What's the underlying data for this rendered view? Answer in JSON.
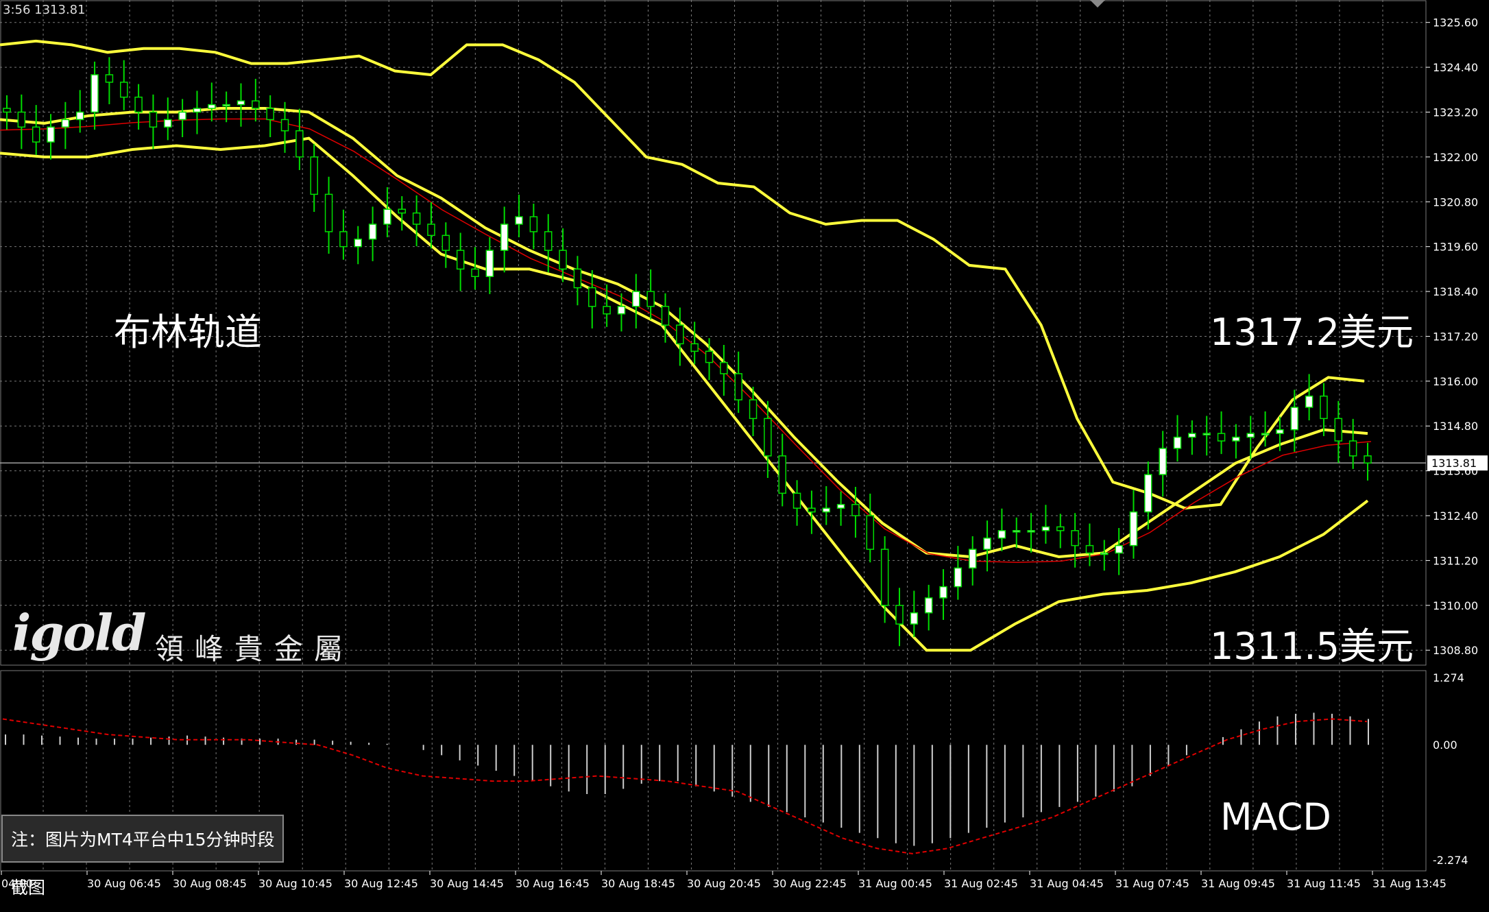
{
  "header": {
    "readout": "3:56 1313.81"
  },
  "annotations": {
    "bollinger_label": "布林轨道",
    "upper_price": "1317.2美元",
    "lower_price": "1311.5美元",
    "macd_label": "MACD",
    "note": "注：图片为MT4平台中15分钟时段截图"
  },
  "logo": {
    "main": "igold",
    "sub": "領峰貴金屬"
  },
  "colors": {
    "background": "#000000",
    "grid": "#7a7a7a",
    "bollinger": "#ffff3c",
    "moving_average": "#e00000",
    "signal": "#e00000",
    "bull_candle": "#ffffff",
    "wick": "#00dd00",
    "histogram": "#cfcfcf",
    "price_line": "#a0a0a0",
    "current_price_box": "#ffffff"
  },
  "chart_data": [
    {
      "type": "candlestick",
      "title": "",
      "current_price": 1313.81,
      "ylim": [
        1308.4,
        1326.2
      ],
      "y_ticks": [
        1325.6,
        1324.4,
        1323.2,
        1322.0,
        1320.8,
        1319.6,
        1318.4,
        1317.2,
        1316.0,
        1314.8,
        1313.6,
        1312.4,
        1311.2,
        1310.0,
        1308.8
      ],
      "y_tick_labels": [
        "1325.60",
        "1324.40",
        "1323.20",
        "1322.00",
        "1320.80",
        "1319.60",
        "1318.40",
        "1317.20",
        "1316.00",
        "1314.80",
        "1313.60",
        "1312.40",
        "1311.20",
        "1310.00",
        "1308.80"
      ],
      "current_price_label": "1313.81",
      "x_ticks": [
        "04:00",
        "30 Aug 06:45",
        "30 Aug 08:45",
        "30 Aug 10:45",
        "30 Aug 12:45",
        "30 Aug 14:45",
        "30 Aug 16:45",
        "30 Aug 18:45",
        "30 Aug 20:45",
        "30 Aug 22:45",
        "31 Aug 00:45",
        "31 Aug 02:45",
        "31 Aug 04:45",
        "31 Aug 07:45",
        "31 Aug 09:45",
        "31 Aug 11:45",
        "31 Aug 13:45"
      ],
      "close": [
        1323.2,
        1322.8,
        1322.4,
        1322.8,
        1323.0,
        1323.2,
        1324.2,
        1324.0,
        1323.6,
        1323.2,
        1322.8,
        1323.0,
        1323.2,
        1323.3,
        1323.4,
        1323.4,
        1323.5,
        1323.3,
        1323.0,
        1322.7,
        1322.0,
        1321.0,
        1320.0,
        1319.6,
        1319.8,
        1320.2,
        1320.6,
        1320.5,
        1320.2,
        1319.9,
        1319.5,
        1319.0,
        1318.8,
        1319.5,
        1320.2,
        1320.4,
        1320.0,
        1319.5,
        1319.0,
        1318.5,
        1318.0,
        1317.8,
        1318.0,
        1318.4,
        1318.0,
        1317.5,
        1317.0,
        1316.8,
        1316.5,
        1316.2,
        1315.5,
        1315.0,
        1314.0,
        1313.0,
        1312.6,
        1312.5,
        1312.6,
        1312.7,
        1312.4,
        1311.5,
        1310.0,
        1309.5,
        1309.8,
        1310.2,
        1310.5,
        1311.0,
        1311.5,
        1311.8,
        1312.0,
        1312.0,
        1312.0,
        1312.1,
        1312.0,
        1311.6,
        1311.4,
        1311.4,
        1311.6,
        1312.5,
        1313.5,
        1314.2,
        1314.5,
        1314.6,
        1314.6,
        1314.4,
        1314.5,
        1314.6,
        1314.6,
        1314.7,
        1315.3,
        1315.6,
        1315.0,
        1314.4,
        1314.0,
        1313.81
      ],
      "bollinger_upper": [
        1325.0,
        1325.1,
        1325.0,
        1324.8,
        1324.9,
        1324.9,
        1324.8,
        1324.5,
        1324.5,
        1324.6,
        1324.7,
        1324.3,
        1324.2,
        1325.0,
        1325.0,
        1324.6,
        1324.0,
        1323.0,
        1322.0,
        1321.8,
        1321.3,
        1321.2,
        1320.5,
        1320.2,
        1320.3,
        1320.3,
        1319.8,
        1319.1,
        1319.0,
        1317.5,
        1315.0,
        1313.3,
        1313.0,
        1312.6,
        1312.7,
        1314.2,
        1315.5,
        1316.1,
        1316.0
      ],
      "bollinger_middle": [
        1323.0,
        1322.9,
        1323.1,
        1323.2,
        1323.2,
        1323.3,
        1323.3,
        1323.2,
        1322.5,
        1321.5,
        1320.9,
        1320.1,
        1319.5,
        1319.0,
        1318.6,
        1318.0,
        1317.0,
        1315.8,
        1314.5,
        1313.3,
        1312.2,
        1311.4,
        1311.3,
        1311.6,
        1311.3,
        1311.4,
        1312.2,
        1313.0,
        1313.8,
        1314.3,
        1314.7,
        1314.6
      ],
      "bollinger_lower": [
        1322.1,
        1322.0,
        1322.0,
        1322.2,
        1322.3,
        1322.2,
        1322.3,
        1322.5,
        1321.5,
        1320.4,
        1319.4,
        1319.0,
        1319.0,
        1318.7,
        1318.1,
        1317.5,
        1316.0,
        1314.5,
        1313.0,
        1311.5,
        1310.0,
        1308.8,
        1308.8,
        1309.5,
        1310.1,
        1310.3,
        1310.4,
        1310.6,
        1310.9,
        1311.3,
        1311.9,
        1312.8
      ],
      "last_close_marker": "1313.81"
    },
    {
      "type": "bar",
      "title": "MACD",
      "ylim": [
        -2.274,
        1.274
      ],
      "y_tick_labels": [
        "1.274",
        "0.00",
        "-2.274"
      ],
      "histogram": [
        0.2,
        0.2,
        0.18,
        0.16,
        0.14,
        0.12,
        0.12,
        0.12,
        0.14,
        0.16,
        0.18,
        0.16,
        0.14,
        0.12,
        0.12,
        0.12,
        0.1,
        0.1,
        0.08,
        0.06,
        0.04,
        0.02,
        0.0,
        -0.1,
        -0.2,
        -0.3,
        -0.4,
        -0.5,
        -0.6,
        -0.7,
        -0.8,
        -0.9,
        -0.95,
        -0.95,
        -0.85,
        -0.75,
        -0.7,
        -0.7,
        -0.8,
        -0.9,
        -1.0,
        -1.1,
        -1.2,
        -1.3,
        -1.4,
        -1.5,
        -1.6,
        -1.7,
        -1.8,
        -1.9,
        -1.95,
        -1.9,
        -1.8,
        -1.7,
        -1.6,
        -1.5,
        -1.4,
        -1.3,
        -1.2,
        -1.1,
        -1.0,
        -0.9,
        -0.8,
        -0.6,
        -0.4,
        -0.2,
        0.0,
        0.15,
        0.3,
        0.45,
        0.55,
        0.6,
        0.62,
        0.6,
        0.55,
        0.5
      ],
      "signal": [
        0.5,
        0.4,
        0.3,
        0.2,
        0.15,
        0.1,
        0.1,
        0.1,
        0.05,
        0.0,
        -0.2,
        -0.45,
        -0.6,
        -0.65,
        -0.7,
        -0.7,
        -0.65,
        -0.6,
        -0.65,
        -0.7,
        -0.8,
        -0.9,
        -1.2,
        -1.5,
        -1.8,
        -2.0,
        -2.1,
        -2.0,
        -1.8,
        -1.6,
        -1.4,
        -1.1,
        -0.8,
        -0.5,
        -0.2,
        0.1,
        0.3,
        0.45,
        0.5,
        0.45
      ]
    }
  ]
}
